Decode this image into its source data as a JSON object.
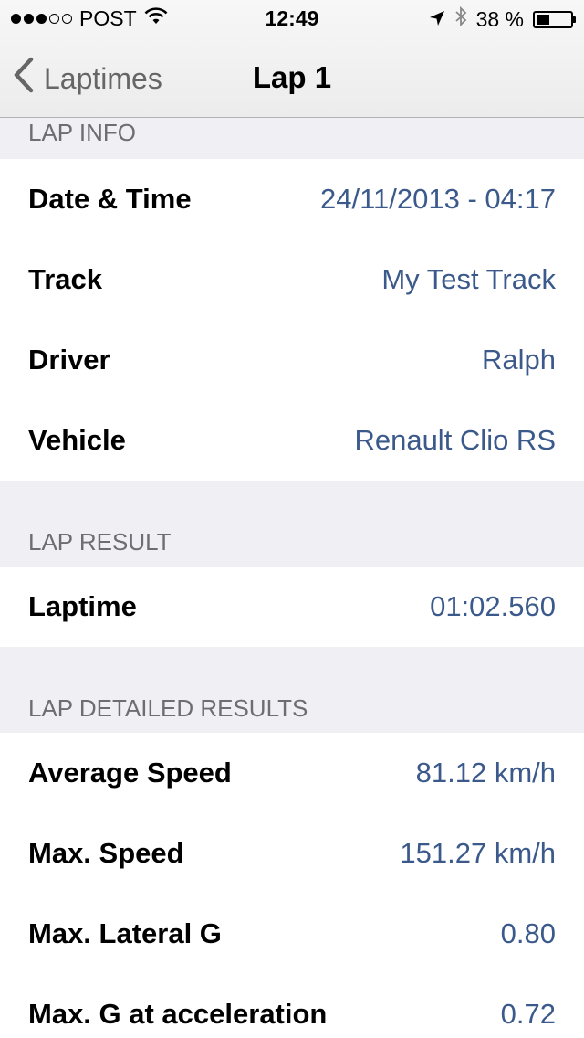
{
  "status_bar": {
    "carrier": "POST",
    "time": "12:49",
    "battery_text": "38 %",
    "battery_level": 0.38,
    "icons": [
      "signal-dots-icon",
      "wifi-icon",
      "location-arrow-icon",
      "bluetooth-icon",
      "battery-icon"
    ]
  },
  "nav": {
    "back_label": "Laptimes",
    "title": "Lap 1"
  },
  "colors": {
    "accent_value": "#3b5a8b",
    "background": "#efeff4",
    "section_header_text": "#6d6d72"
  },
  "sections": {
    "lap_info": {
      "header": "LAP INFO",
      "rows": [
        {
          "label": "Date & Time",
          "value": "24/11/2013 - 04:17"
        },
        {
          "label": "Track",
          "value": "My Test Track"
        },
        {
          "label": "Driver",
          "value": "Ralph"
        },
        {
          "label": "Vehicle",
          "value": "Renault Clio RS"
        }
      ]
    },
    "lap_result": {
      "header": "LAP RESULT",
      "rows": [
        {
          "label": "Laptime",
          "value": "01:02.560"
        }
      ]
    },
    "lap_detailed": {
      "header": "LAP DETAILED RESULTS",
      "rows": [
        {
          "label": "Average Speed",
          "value": "81.12 km/h"
        },
        {
          "label": "Max. Speed",
          "value": "151.27 km/h"
        },
        {
          "label": "Max. Lateral G",
          "value": "0.80"
        },
        {
          "label": "Max. G at acceleration",
          "value": "0.72"
        }
      ]
    }
  }
}
